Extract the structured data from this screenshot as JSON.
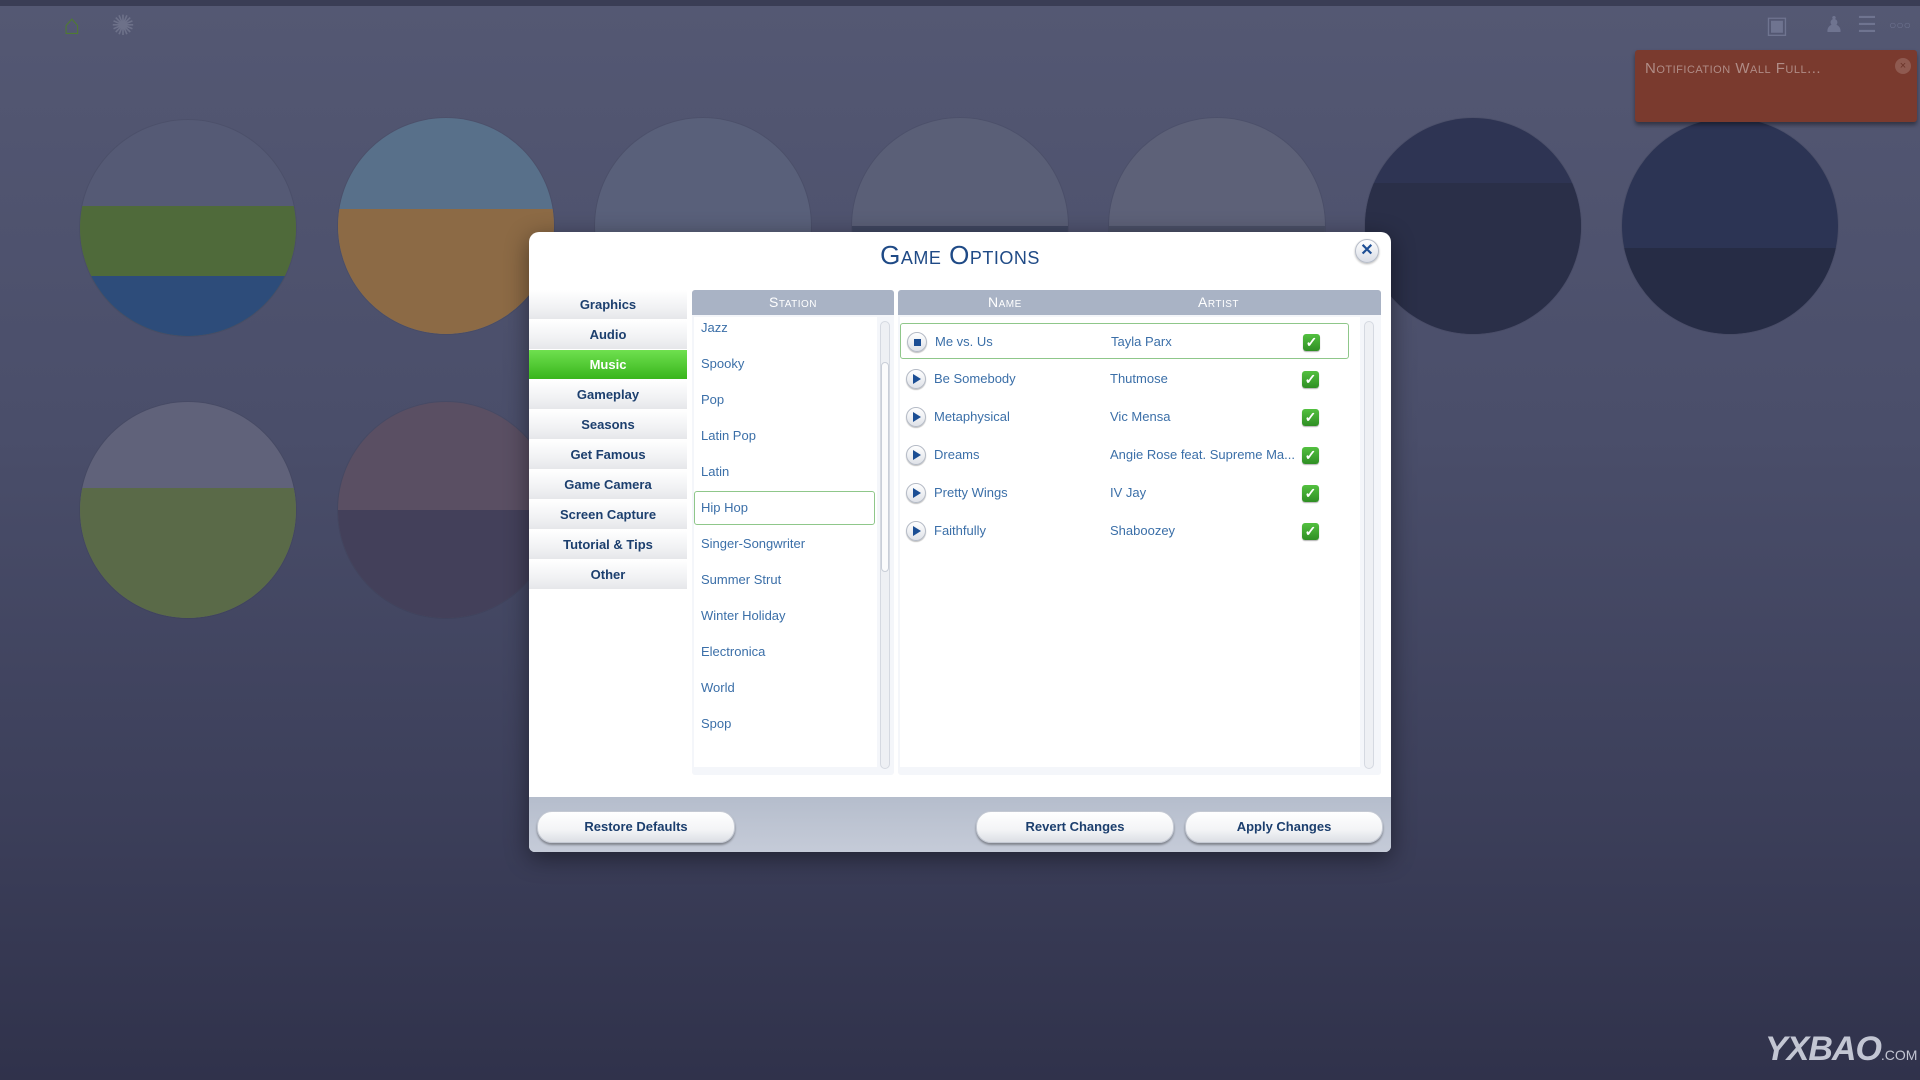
{
  "hud": {
    "home_icon": "house-icon",
    "sun_icon": "sun-icon",
    "right_icons": [
      "gallery-icon",
      "relationships-icon",
      "list-icon",
      "more-icon"
    ],
    "more_glyph": "○○○"
  },
  "notification": {
    "text": "Notification Wall Full...",
    "close_glyph": "×",
    "color": "#7a3a2e"
  },
  "dialog": {
    "title": "Game Options",
    "close_glyph": "✕",
    "sidebar": {
      "items": [
        {
          "label": "Graphics",
          "active": false
        },
        {
          "label": "Audio",
          "active": false
        },
        {
          "label": "Music",
          "active": true
        },
        {
          "label": "Gameplay",
          "active": false
        },
        {
          "label": "Seasons",
          "active": false
        },
        {
          "label": "Get Famous",
          "active": false
        },
        {
          "label": "Game Camera",
          "active": false
        },
        {
          "label": "Screen Capture",
          "active": false
        },
        {
          "label": "Tutorial & Tips",
          "active": false
        },
        {
          "label": "Other",
          "active": false
        }
      ],
      "active_color": "#4cc832"
    },
    "stations": {
      "header": "Station",
      "selected": "Hip Hop",
      "items": [
        "Jazz",
        "Spooky",
        "Pop",
        "Latin Pop",
        "Latin",
        "Hip Hop",
        "Singer-Songwriter",
        "Summer Strut",
        "Winter Holiday",
        "Electronica",
        "World",
        "Spop"
      ]
    },
    "songs": {
      "headers": {
        "name": "Name",
        "artist": "Artist"
      },
      "rows": [
        {
          "name": "Me vs. Us",
          "artist": "Tayla Parx",
          "enabled": true,
          "state": "playing",
          "control_icon": "stop-icon"
        },
        {
          "name": "Be Somebody",
          "artist": "Thutmose",
          "enabled": true,
          "state": "stopped",
          "control_icon": "play-icon"
        },
        {
          "name": "Metaphysical",
          "artist": "Vic Mensa",
          "enabled": true,
          "state": "stopped",
          "control_icon": "play-icon"
        },
        {
          "name": "Dreams",
          "artist": "Angie Rose feat. Supreme Ma...",
          "enabled": true,
          "state": "stopped",
          "control_icon": "play-icon"
        },
        {
          "name": "Pretty Wings",
          "artist": "IV Jay",
          "enabled": true,
          "state": "stopped",
          "control_icon": "play-icon"
        },
        {
          "name": "Faithfully",
          "artist": "Shaboozey",
          "enabled": true,
          "state": "stopped",
          "control_icon": "play-icon"
        }
      ],
      "check_glyph": "✓"
    },
    "footer": {
      "restore_label": "Restore Defaults",
      "revert_label": "Revert Changes",
      "apply_label": "Apply Changes"
    }
  },
  "watermark": {
    "brand": "YXBAO",
    "suffix": ".COM"
  }
}
